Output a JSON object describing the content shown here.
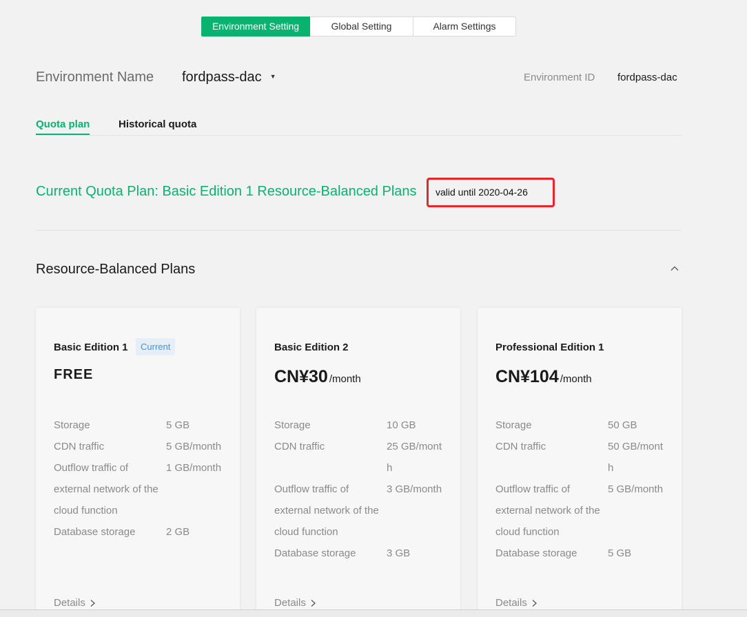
{
  "top_tabs": [
    {
      "label": "Environment Setting",
      "active": true
    },
    {
      "label": "Global Setting",
      "active": false
    },
    {
      "label": "Alarm Settings",
      "active": false
    }
  ],
  "environment": {
    "name_label": "Environment Name",
    "name_value": "fordpass-dac",
    "id_label": "Environment ID",
    "id_value": "fordpass-dac"
  },
  "sub_tabs": [
    {
      "label": "Quota plan",
      "active": true
    },
    {
      "label": "Historical quota",
      "active": false
    }
  ],
  "current_quota": {
    "text": "Current Quota Plan: Basic Edition 1 Resource-Balanced Plans",
    "valid_until": "valid until 2020-04-26"
  },
  "section": {
    "title": "Resource-Balanced Plans",
    "collapse_icon": "chevron-up-icon"
  },
  "cards": [
    {
      "name": "Basic Edition 1",
      "badge": "Current",
      "price": "FREE",
      "per": "",
      "specs": [
        {
          "k": "Storage",
          "v": "5 GB"
        },
        {
          "k": "CDN traffic",
          "v": "5 GB/month"
        },
        {
          "k": "Outflow traffic of external network of the cloud function",
          "v": "1 GB/month"
        },
        {
          "k": "Database storage",
          "v": "2 GB"
        }
      ],
      "details": "Details"
    },
    {
      "name": "Basic Edition 2",
      "badge": "",
      "price": "CN¥30",
      "per": "/month",
      "specs": [
        {
          "k": "Storage",
          "v": "10 GB"
        },
        {
          "k": "CDN traffic",
          "v": "25 GB/month"
        },
        {
          "k": "Outflow traffic of external network of the cloud function",
          "v": "3 GB/month"
        },
        {
          "k": "Database storage",
          "v": "3 GB"
        }
      ],
      "details": "Details"
    },
    {
      "name": "Professional Edition 1",
      "badge": "",
      "price": "CN¥104",
      "per": "/month",
      "specs": [
        {
          "k": "Storage",
          "v": "50 GB"
        },
        {
          "k": "CDN traffic",
          "v": "50 GB/month"
        },
        {
          "k": "Outflow traffic of external network of the cloud function",
          "v": "5 GB/month"
        },
        {
          "k": "Database storage",
          "v": "5 GB"
        }
      ],
      "details": "Details"
    }
  ],
  "colors": {
    "accent": "#07b36f",
    "highlight_border": "#e5262b",
    "badge_text": "#4a90d9"
  }
}
